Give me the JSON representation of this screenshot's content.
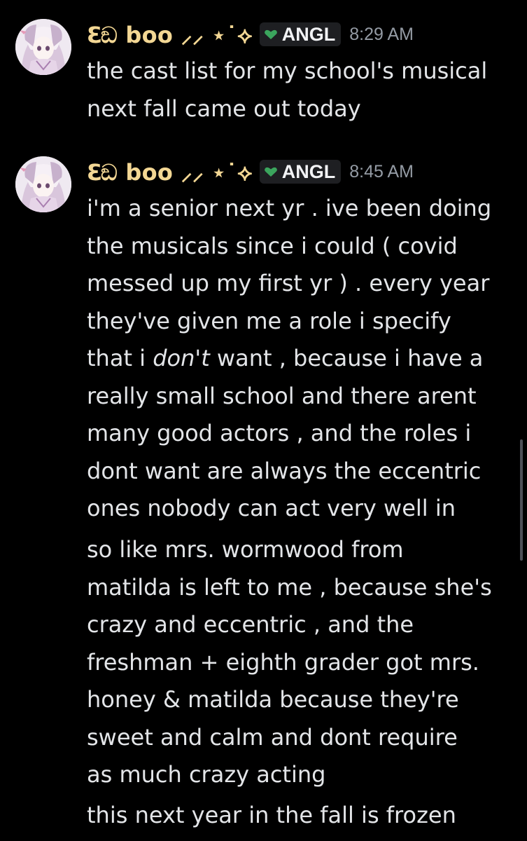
{
  "messages": [
    {
      "username": "ℇඞ boo ⸝⸝ ⋆˙⟡",
      "tag": "ANGL",
      "timestamp": "8:29 AM",
      "lines": [
        "the cast list for my school's musical",
        "next fall came out today"
      ]
    },
    {
      "username": "ℇඞ boo ⸝⸝ ⋆˙⟡",
      "tag": "ANGL",
      "timestamp": "8:45 AM",
      "lines": [
        "i'm a senior next yr . ive been doing",
        "the musicals since i could ( covid",
        "messed up my first yr ) . every year",
        "they've given me a role i specify",
        "that i ",
        "really small school and there arent",
        "many good actors , and the roles i",
        "dont want are always the eccentric",
        "ones nobody can act very well in"
      ],
      "emphasis_line": {
        "before": "that i ",
        "italic": "don't",
        "after": " want , because i have a"
      }
    },
    {
      "lines": [
        "so like mrs. wormwood from",
        "matilda is left to me , because she's",
        "crazy and eccentric , and the",
        "freshman + eighth grader got mrs.",
        "honey & matilda because they're",
        "sweet and calm and dont require",
        "as much crazy acting"
      ]
    },
    {
      "lines": [
        "this next year in the fall is frozen"
      ]
    }
  ],
  "colors": {
    "background": "#000000",
    "username": "#f3d794",
    "tag_bg": "#1e1f22",
    "tag_icon": "#3ba55d",
    "timestamp": "#949ba4",
    "message_text": "#e3e5e8"
  },
  "icons": {
    "avatar": "anime-girl-avatar",
    "tag": "green-heart-icon"
  }
}
